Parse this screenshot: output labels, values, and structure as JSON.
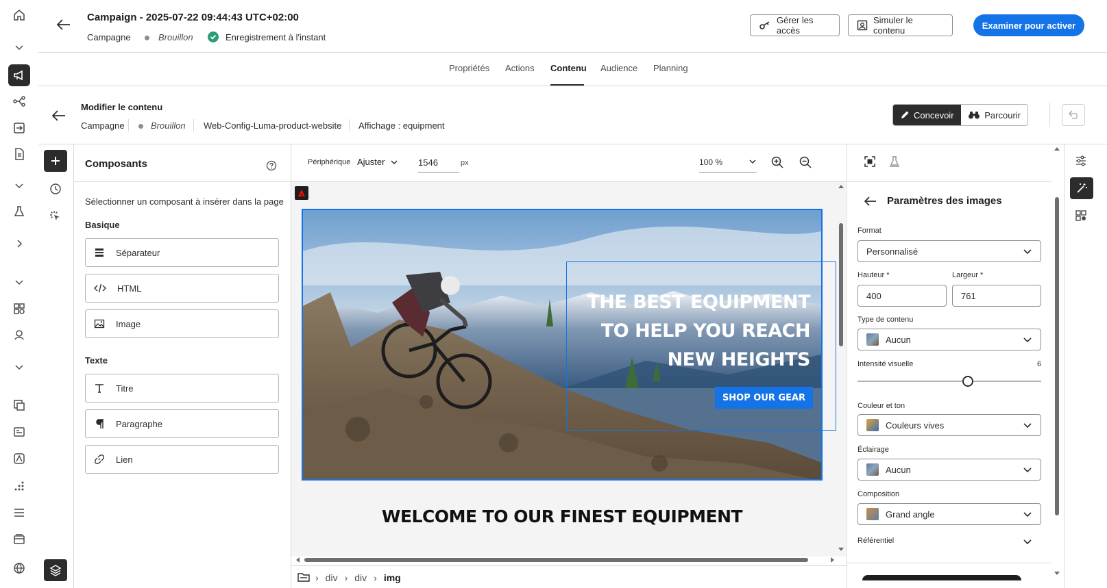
{
  "header": {
    "title": "Campaign - 2025-07-22 09:44:43 UTC+02:00",
    "type": "Campagne",
    "status": "Brouillon",
    "saved": "Enregistrement à l'instant",
    "manage_access": "Gérer les accès",
    "simulate": "Simuler le contenu",
    "review": "Examiner pour activer"
  },
  "tabs": [
    "Propriétés",
    "Actions",
    "Contenu",
    "Audience",
    "Planning"
  ],
  "editor": {
    "title": "Modifier le contenu",
    "crumbs": [
      "Campagne",
      "Brouillon",
      "Web-Config-Luma-product-website",
      "Affichage : equipment"
    ],
    "design": "Concevoir",
    "browse": "Parcourir"
  },
  "components": {
    "title": "Composants",
    "hint": "Sélectionner un composant à insérer dans la page",
    "basic_title": "Basique",
    "basic": [
      "Séparateur",
      "HTML",
      "Image"
    ],
    "text_title": "Texte",
    "text": [
      "Titre",
      "Paragraphe",
      "Lien"
    ]
  },
  "canvas_toolbar": {
    "device_label": "Périphérique",
    "device_value": "Ajuster",
    "width": "1546",
    "unit": "px",
    "zoom": "100 %"
  },
  "canvas": {
    "hero_line1": "THE BEST EQUIPMENT",
    "hero_line2": "TO HELP YOU REACH",
    "hero_line3": "NEW HEIGHTS",
    "cta": "SHOP OUR GEAR",
    "welcome": "WELCOME TO OUR FINEST EQUIPMENT",
    "path": [
      "div",
      "div",
      "img"
    ]
  },
  "image_panel": {
    "title": "Paramètres des images",
    "format_label": "Format",
    "format_value": "Personnalisé",
    "height_label": "Hauteur",
    "height_value": "400",
    "width_label": "Largeur",
    "width_value": "761",
    "content_type_label": "Type de contenu",
    "content_type_value": "Aucun",
    "intensity_label": "Intensité visuelle",
    "intensity_value": "6",
    "intensity_fraction": 0.6,
    "color_label": "Couleur et ton",
    "color_value": "Couleurs vives",
    "lighting_label": "Éclairage",
    "lighting_value": "Aucun",
    "composition_label": "Composition",
    "composition_value": "Grand angle",
    "reference_label": "Référentiel",
    "required_marker": "*"
  },
  "colors": {
    "accent": "#1473e6",
    "dark": "#2c2c2c",
    "success": "#2d9d78"
  }
}
